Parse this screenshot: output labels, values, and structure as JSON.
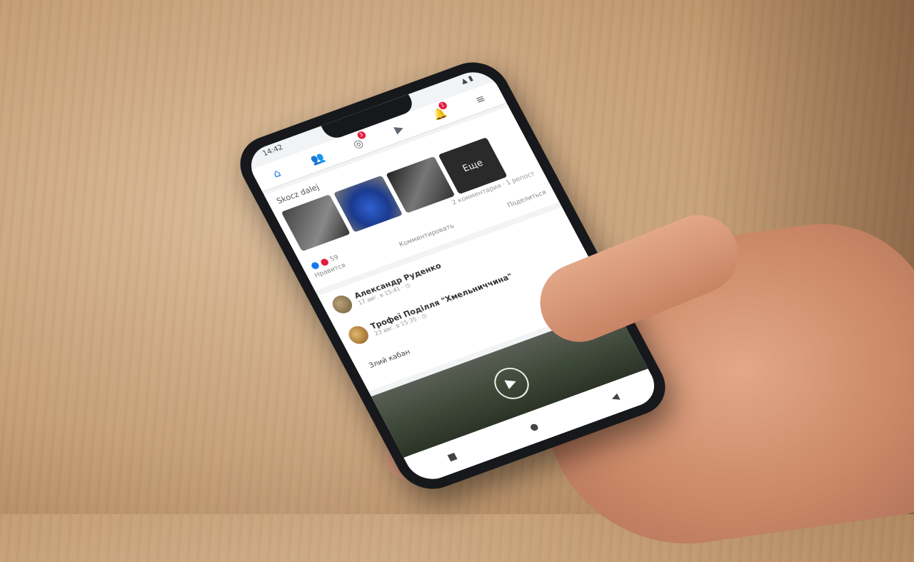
{
  "status": {
    "time": "14:42"
  },
  "nav": {
    "icons": [
      "home-icon",
      "friends-icon",
      "groups-icon",
      "video-icon",
      "bell-icon",
      "menu-icon"
    ],
    "groups_badge": "3",
    "notifications_badge": "1"
  },
  "card1": {
    "skip_label": "Skocz dalej",
    "more_label": "Еще",
    "meta": "2 комментария · 1 репост",
    "reactions_count": "59",
    "actions": [
      "Нравится",
      "Комментировать",
      "Поделиться"
    ]
  },
  "card2": {
    "author1": "Александр Руденко",
    "time1": "17 авг. в 15:41 · ◷",
    "author2": "Трофеї Поділля \"Хмельниччина\"",
    "time2": "23 авг. в 15:35 · ◷",
    "post_text": "Злий кабан"
  },
  "colors": {
    "accent": "#1877f2",
    "badge": "#e41e3f"
  }
}
